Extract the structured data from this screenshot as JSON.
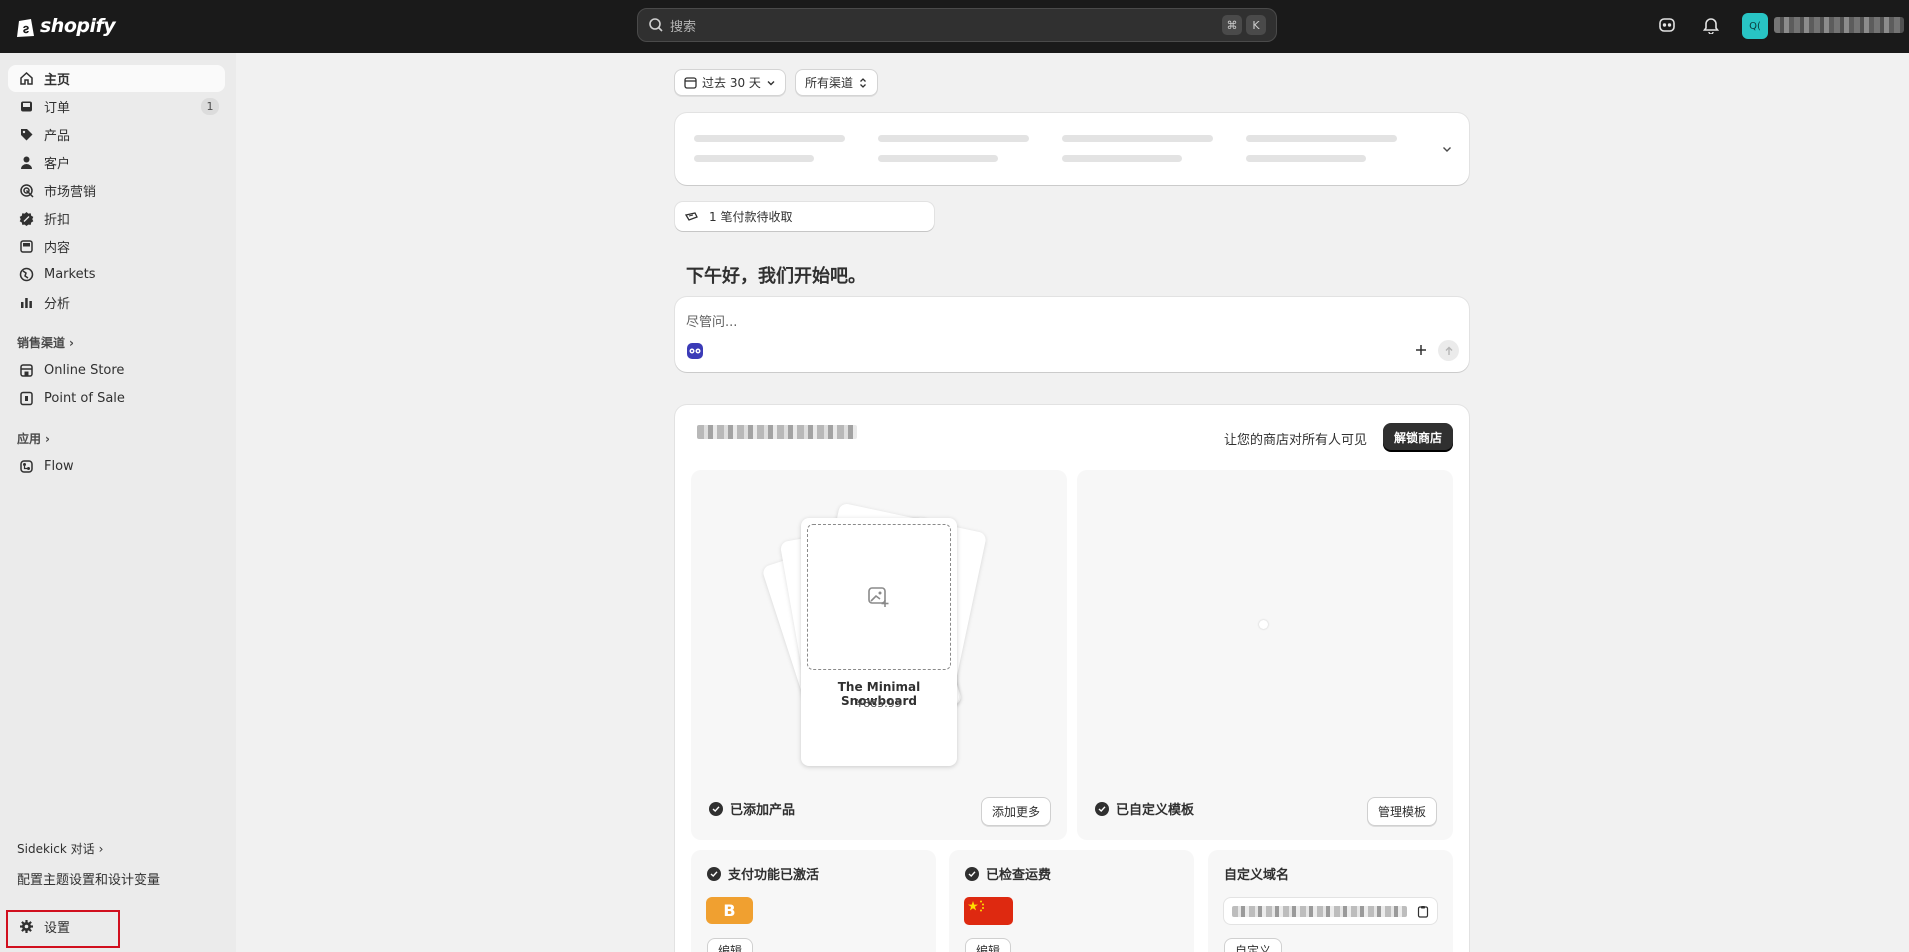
{
  "topbar": {
    "logo_text": "shopify",
    "search_placeholder": "搜索",
    "shortcut_key1": "⌘",
    "shortcut_key2": "K",
    "avatar_initials": "Q("
  },
  "sidebar": {
    "items": [
      {
        "label": "主页",
        "icon": "home-icon"
      },
      {
        "label": "订单",
        "icon": "inbox-icon",
        "badge": "1"
      },
      {
        "label": "产品",
        "icon": "tag-icon"
      },
      {
        "label": "客户",
        "icon": "person-icon"
      },
      {
        "label": "市场营销",
        "icon": "target-icon"
      },
      {
        "label": "折扣",
        "icon": "discount-icon"
      },
      {
        "label": "内容",
        "icon": "content-icon"
      },
      {
        "label": "Markets",
        "icon": "globe-icon"
      },
      {
        "label": "分析",
        "icon": "bar-chart-icon"
      }
    ],
    "sales_channels_label": "销售渠道",
    "channels": [
      {
        "label": "Online Store",
        "icon": "store-icon"
      },
      {
        "label": "Point of Sale",
        "icon": "pos-icon"
      }
    ],
    "apps_label": "应用",
    "apps": [
      {
        "label": "Flow",
        "icon": "flow-icon"
      }
    ],
    "sidekick_label": "Sidekick 对话",
    "sidekick_item": "配置主题设置和设计变量",
    "settings_label": "设置"
  },
  "main": {
    "date_filter": "过去 30 天",
    "channel_filter": "所有渠道",
    "payments_notice": "1 笔付款待收取",
    "greeting": "下午好，我们开始吧。",
    "ask_placeholder": "尽管问...",
    "store": {
      "visible_text": "让您的商店对所有人可见",
      "unlock_button": "解锁商店",
      "product_name": "The Minimal Snowboard",
      "product_price": "¥885.95",
      "products_status": "已添加产品",
      "add_more_button": "添加更多",
      "template_status": "已自定义模板",
      "manage_template_button": "管理模板",
      "payments_status": "支付功能已激活",
      "payments_badge": "B",
      "payments_edit": "编辑",
      "shipping_status": "已检查运费",
      "shipping_edit": "编辑",
      "domain_title": "自定义域名",
      "domain_button": "自定义"
    }
  },
  "colors": {
    "topbar_bg": "#1a1a1a",
    "sidebar_bg": "#ebebeb",
    "avatar": "#28c4c4",
    "highlight_border": "#d10f1e",
    "payment_badge": "#f0a030",
    "flag_red": "#de2910"
  }
}
